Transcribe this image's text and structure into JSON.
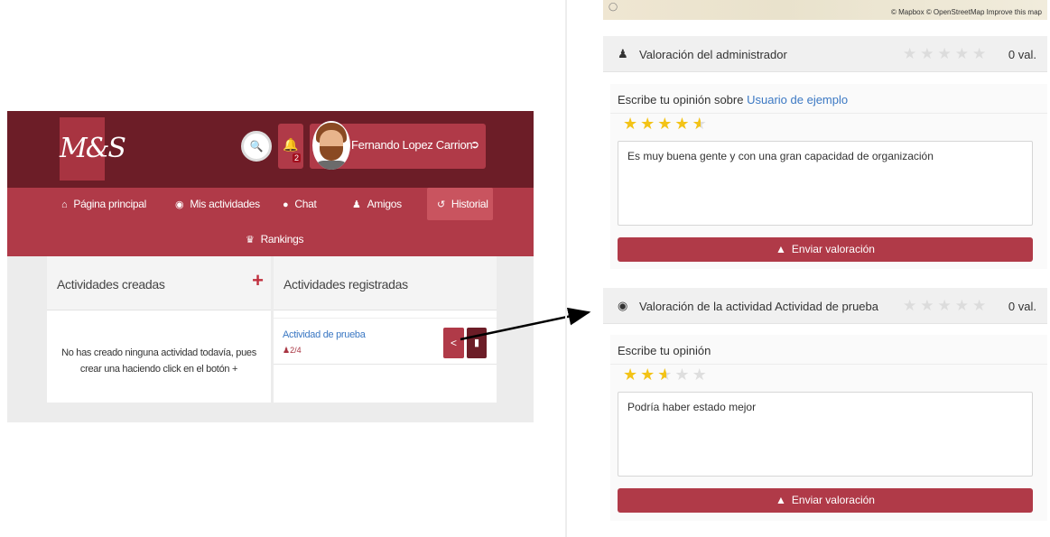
{
  "left": {
    "logo_text": "M&S",
    "notification_count": "2",
    "user_name": "Fernando Lopez Carrion",
    "nav": {
      "home": "Página principal",
      "my_activities": "Mis actividades",
      "chat": "Chat",
      "friends": "Amigos",
      "history": "Historial",
      "rankings": "Rankings"
    },
    "created_panel": {
      "title": "Actividades creadas",
      "empty_message": "No has creado ninguna actividad todavía, pues crear una haciendo click en el botón +"
    },
    "registered_panel": {
      "title": "Actividades registradas",
      "activity_name": "Actividad de prueba",
      "participants": "2/4"
    }
  },
  "right": {
    "map_attribution": "© Mapbox © OpenStreetMap Improve this map",
    "admin_rating": {
      "title": "Valoración del administrador",
      "value_label": "0 val.",
      "form_label_prefix": "Escribe tu opinión sobre",
      "form_label_user": "Usuario de ejemplo",
      "stars": 4.5,
      "comment": "Es muy buena gente y con una gran capacidad de organización",
      "submit_label": "Enviar valoración"
    },
    "activity_rating": {
      "title": "Valoración de la actividad Actividad de prueba",
      "value_label": "0 val.",
      "form_label": "Escribe tu opinión",
      "stars": 2.5,
      "comment": "Podría haber estado mejor",
      "submit_label": "Enviar valoración"
    }
  },
  "colors": {
    "dark_red": "#6c1d27",
    "brand_red": "#b03a48",
    "link_blue": "#3b78c3",
    "star_gold": "#f3c317"
  },
  "icons": [
    "search-icon",
    "bell-icon",
    "logout-icon",
    "home-icon",
    "location-pin-icon",
    "chat-bubble-icon",
    "users-icon",
    "history-icon",
    "crown-icon",
    "plus-icon",
    "user-icon",
    "share-icon",
    "trash-icon",
    "thumbs-up-icon",
    "star-icon"
  ]
}
